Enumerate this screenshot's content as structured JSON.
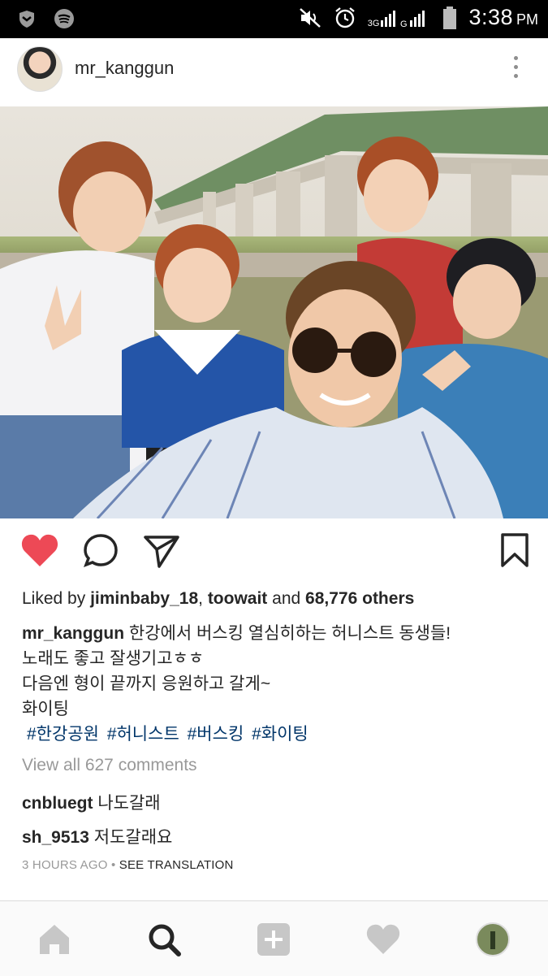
{
  "status_bar": {
    "time": "3:38",
    "ampm": "PM",
    "network": "3G",
    "icons": [
      "shield-icon",
      "spotify-icon",
      "mute-icon",
      "alarm-icon",
      "signal-icon",
      "battery-icon"
    ]
  },
  "post": {
    "username": "mr_kanggun",
    "likes": {
      "prefix": "Liked by",
      "user1": "jiminbaby_18",
      "sep": ",",
      "user2": "toowait",
      "and": "and",
      "others": "68,776 others"
    },
    "caption": {
      "username": "mr_kanggun",
      "line1": "한강에서 버스킹 열심히하는 허니스트 동생들!",
      "line2": "노래도 좋고 잘생기고ㅎㅎ",
      "line3": "다음엔 형이 끝까지 응원하고 갈게~",
      "line4": "화이팅",
      "hashtags": [
        "#한강공원",
        "#허니스트",
        "#버스킹",
        "#화이팅"
      ]
    },
    "view_all": "View all 627 comments",
    "comments": [
      {
        "user": "cnbluegt",
        "text": "나도갈래"
      },
      {
        "user": "sh_9513",
        "text": "저도갈래요"
      }
    ],
    "time_ago": "3 HOURS AGO",
    "dot": "•",
    "see_translation": "SEE TRANSLATION"
  },
  "colors": {
    "like_red": "#ed4956",
    "hashtag_blue": "#003569",
    "muted_gray": "#999999"
  },
  "bottom_nav": [
    "home-icon",
    "search-icon",
    "add-icon",
    "heart-icon",
    "profile-avatar"
  ]
}
